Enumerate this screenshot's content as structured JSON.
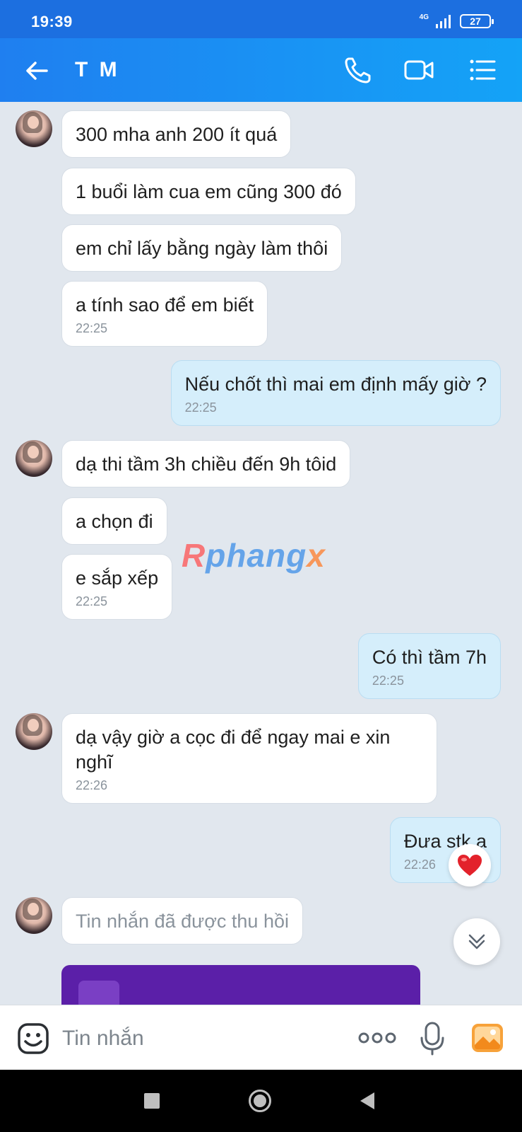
{
  "status_bar": {
    "time": "19:39",
    "network": "4G",
    "battery": "27"
  },
  "header": {
    "title": "T M"
  },
  "messages": [
    {
      "direction": "in",
      "text": "300 mha anh 200 ít quá",
      "time": ""
    },
    {
      "direction": "in",
      "text": "1 buổi làm cua em cũng 300 đó",
      "time": ""
    },
    {
      "direction": "in",
      "text": "em chỉ lấy bằng ngày làm thôi",
      "time": ""
    },
    {
      "direction": "in",
      "text": "a tính sao để em biết",
      "time": "22:25"
    },
    {
      "direction": "out",
      "text": "Nếu chốt thì mai em định mấy giờ ?",
      "time": "22:25"
    },
    {
      "direction": "in",
      "text": "dạ thi tầm 3h chiều đến 9h tôid",
      "time": ""
    },
    {
      "direction": "in",
      "text": "a chọn đi",
      "time": ""
    },
    {
      "direction": "in",
      "text": "e sắp xếp",
      "time": "22:25"
    },
    {
      "direction": "out",
      "text": "Có thì tầm 7h",
      "time": "22:25"
    },
    {
      "direction": "in",
      "text": "dạ vậy giờ a cọc đi để ngay mai e xin nghĩ",
      "time": "22:26"
    },
    {
      "direction": "out",
      "text": "Đưa stk a",
      "time": "22:26"
    },
    {
      "direction": "in",
      "text": "Tin nhắn đã được thu hồi",
      "time": ""
    }
  ],
  "watermark": {
    "part1": "R",
    "part2": "phang",
    "part3": "x"
  },
  "input": {
    "placeholder": "Tin nhắn"
  },
  "colors": {
    "header_start": "#1f7ff0",
    "header_end": "#14a3f7",
    "outgoing_bubble": "#d5eefb",
    "chat_background": "#e1e7ee"
  },
  "icons": [
    "back-arrow-icon",
    "phone-icon",
    "video-call-icon",
    "menu-list-icon",
    "heart-reaction-icon",
    "chevron-double-down-icon",
    "emoji-icon",
    "more-dots-icon",
    "microphone-icon",
    "gallery-icon",
    "nav-recents-icon",
    "nav-home-icon",
    "nav-back-icon"
  ]
}
